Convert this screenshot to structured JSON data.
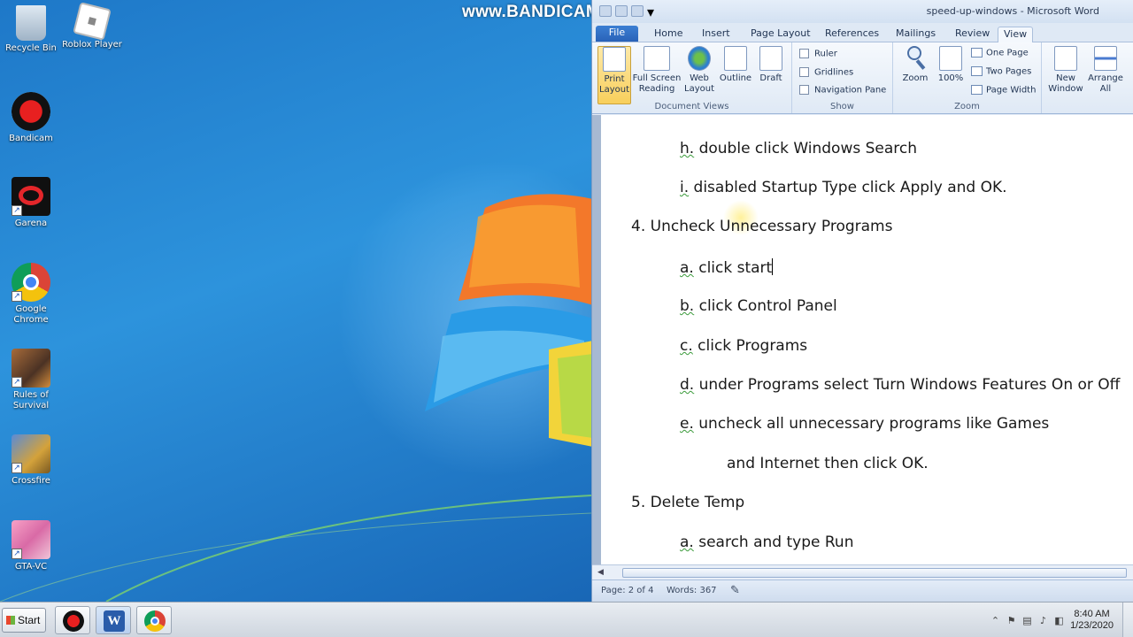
{
  "watermark": "www.BANDICAM.com",
  "desktop_icons": [
    {
      "label": "Recycle Bin",
      "icon": "recycle-bin-icon"
    },
    {
      "label": "Roblox Player",
      "icon": "roblox-icon"
    },
    {
      "label": "Bandicam",
      "icon": "bandicam-icon"
    },
    {
      "label": "Garena",
      "icon": "garena-icon"
    },
    {
      "label": "Google Chrome",
      "icon": "chrome-icon"
    },
    {
      "label": "Rules of Survival",
      "icon": "game-icon"
    },
    {
      "label": "Crossfire",
      "icon": "crossfire-icon"
    },
    {
      "label": "GTA-VC",
      "icon": "gta-icon"
    }
  ],
  "word": {
    "title": "speed-up-windows - Microsoft Word",
    "tabs": [
      "File",
      "Home",
      "Insert",
      "Page Layout",
      "References",
      "Mailings",
      "Review",
      "View"
    ],
    "active_tab": "View",
    "ribbon": {
      "document_views": {
        "label": "Document Views",
        "buttons": [
          "Print Layout",
          "Full Screen Reading",
          "Web Layout",
          "Outline",
          "Draft"
        ]
      },
      "show": {
        "label": "Show",
        "checkboxes": [
          "Ruler",
          "Gridlines",
          "Navigation Pane"
        ]
      },
      "zoom": {
        "label": "Zoom",
        "buttons": [
          "Zoom",
          "100%"
        ],
        "small": [
          "One Page",
          "Two Pages",
          "Page Width"
        ]
      },
      "window": {
        "buttons": [
          "New Window",
          "Arrange All"
        ]
      }
    },
    "document": {
      "lines": [
        {
          "num": "h.",
          "text": " double click Windows Search"
        },
        {
          "num": "i.",
          "text": " disabled Startup Type click Apply and OK."
        },
        {
          "num": "4.",
          "text": "  Uncheck Unnecessary Programs"
        },
        {
          "num": "a.",
          "text": " click start"
        },
        {
          "num": "b.",
          "text": " click Control Panel"
        },
        {
          "num": "c.",
          "text": " click Programs"
        },
        {
          "num": "d.",
          "text": " under Programs select Turn Windows Features On or Off"
        },
        {
          "num": "e.",
          "text": " uncheck all unnecessary programs like Games"
        },
        {
          "num": "",
          "text": "and Internet then click OK."
        },
        {
          "num": "5.",
          "text": " Delete Temp"
        },
        {
          "num": "a.",
          "text": " search and type Run"
        }
      ]
    },
    "status": {
      "page": "Page: 2 of 4",
      "words": "Words: 367"
    }
  },
  "taskbar": {
    "start_label": "Start",
    "time": "8:40 AM",
    "date": "1/23/2020"
  }
}
